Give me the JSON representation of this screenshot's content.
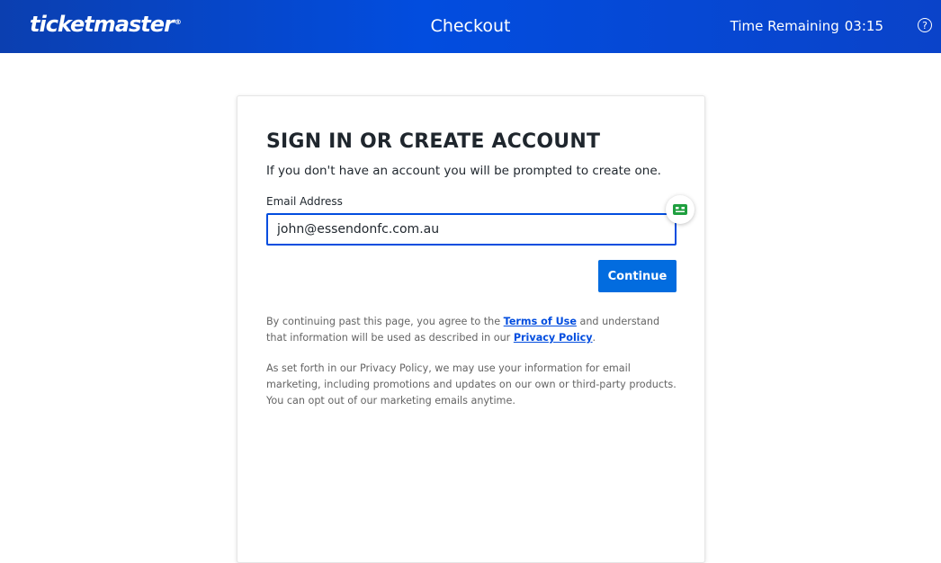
{
  "header": {
    "logo_text": "ticketmaster",
    "logo_reg": "®",
    "title": "Checkout",
    "timer_label": "Time Remaining",
    "timer_value": "03:15",
    "help_symbol": "?",
    "help_icon": "question-circle-icon",
    "background_color": "#024ddf"
  },
  "form": {
    "title": "SIGN IN OR CREATE ACCOUNT",
    "subtitle": "If you don't have an account you will be prompted to create one.",
    "email_label": "Email Address",
    "email_value": "john@essendonfc.com.au",
    "autofill_icon": "password-manager-icon",
    "continue_label": "Continue",
    "accent_color": "#026cdf"
  },
  "legal": {
    "p1_before": "By continuing past this page, you agree to the ",
    "terms_link": "Terms of Use",
    "p1_middle": " and understand that information will be used as described in our ",
    "privacy_link": "Privacy Policy",
    "p1_after": ".",
    "p2": "As set forth in our Privacy Policy, we may use your information for email marketing, including promotions and updates on our own or third-party products. You can opt out of our marketing emails anytime."
  }
}
